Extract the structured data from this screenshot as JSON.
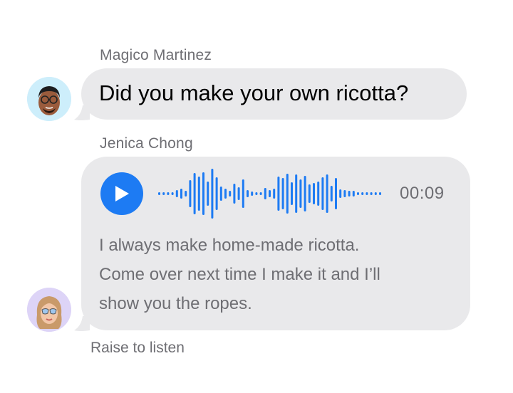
{
  "conversation": {
    "messages": [
      {
        "sender": "Magico Martinez",
        "avatar_icon": "memoji-man-glasses-icon",
        "text": "Did you make your own ricotta?"
      },
      {
        "sender": "Jenica Chong",
        "avatar_icon": "memoji-woman-sunglasses-icon",
        "audio": {
          "duration": "00:09",
          "play_icon": "play-icon",
          "transcript_lines": [
            "I always make home-made ricotta.",
            "Come over next time I make it and I’ll",
            "show you the ropes."
          ]
        }
      }
    ],
    "footer_hint": "Raise to listen"
  },
  "colors": {
    "bubble": "#e9e9eb",
    "accent": "#1d7bf3",
    "secondary_text": "#6e6e73",
    "avatar1_bg": "#cdeefb",
    "avatar2_bg": "#ddd4f7"
  }
}
